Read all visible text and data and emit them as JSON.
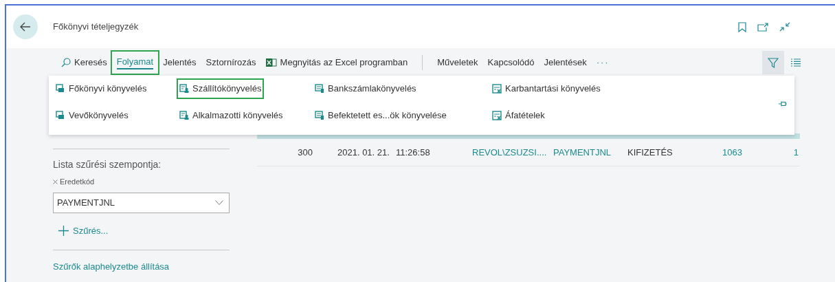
{
  "page": {
    "title": "Főkönyvi tételjegyzék"
  },
  "action_bar": {
    "items": [
      {
        "kind": "search",
        "label": "Keresés",
        "selected": false,
        "highlighted": false
      },
      {
        "kind": "tab",
        "label": "Folyamat",
        "selected": true,
        "highlighted": true
      },
      {
        "kind": "tab",
        "label": "Jelentés",
        "selected": false,
        "highlighted": false
      },
      {
        "kind": "tab",
        "label": "Sztornírozás",
        "selected": false,
        "highlighted": false
      },
      {
        "kind": "excel",
        "label": "Megnyitás az Excel programban",
        "selected": false,
        "highlighted": false
      },
      {
        "kind": "divider"
      },
      {
        "kind": "tab",
        "label": "Műveletek",
        "selected": false,
        "highlighted": false
      },
      {
        "kind": "tab",
        "label": "Kapcsolódó",
        "selected": false,
        "highlighted": false
      },
      {
        "kind": "tab",
        "label": "Jelentések",
        "selected": false,
        "highlighted": false
      },
      {
        "kind": "more",
        "label": "···"
      }
    ],
    "filter_toggle": {
      "selected": true
    }
  },
  "menu": {
    "columns": [
      [
        {
          "label": "Főkönyvi könyvelés",
          "highlighted": false
        },
        {
          "label": "Vevőkönyvelés",
          "highlighted": false
        }
      ],
      [
        {
          "label": "Szállítókönyvelés",
          "highlighted": true
        },
        {
          "label": "Alkalmazotti könyvelés",
          "highlighted": false
        }
      ],
      [
        {
          "label": "Bankszámlakönyvelés",
          "highlighted": false
        },
        {
          "label": "Befektetett es...ök könyvelése",
          "highlighted": false
        }
      ],
      [
        {
          "label": "Karbantartási könyvelés",
          "highlighted": false
        },
        {
          "label": "Áfatételek",
          "highlighted": false
        }
      ]
    ]
  },
  "filter_pane": {
    "heading": "Lista szűrési szempontja:",
    "filters": [
      {
        "field": "Eredetkód",
        "value": "PAYMENTJNL"
      }
    ],
    "add_filter": "Szűrés...",
    "reset": "Szűrők alaphelyzetbe állítása"
  },
  "table": {
    "rows": [
      {
        "selected": false,
        "cells": [
          {
            "kind": "number",
            "text": "300"
          },
          {
            "kind": "text",
            "text": "2021. 01. 21."
          },
          {
            "kind": "text",
            "text": "11:26:58"
          },
          {
            "kind": "link",
            "text": "REVOL\\ZSUZSI...."
          },
          {
            "kind": "link",
            "text": "PAYMENTJNL"
          },
          {
            "kind": "text",
            "text": "KIFIZETÉS"
          },
          {
            "kind": "link_number",
            "text": "1063"
          },
          {
            "kind": "link_number",
            "text": "1"
          }
        ]
      }
    ]
  }
}
